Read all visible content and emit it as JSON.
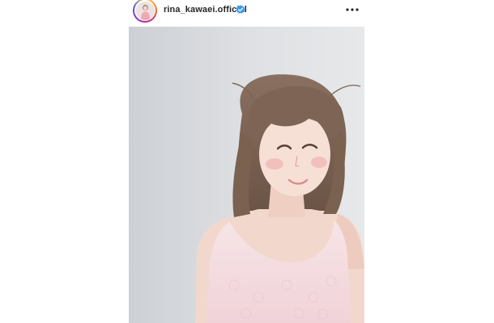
{
  "post": {
    "username": "rina_kawaei.official",
    "verified": true,
    "avatar_icon": "profile-photo-avatar",
    "verified_icon": "verified-badge-icon",
    "more_icon": "more-options-icon",
    "accent_color": "#3897f0",
    "photo_subject": "portrait"
  }
}
